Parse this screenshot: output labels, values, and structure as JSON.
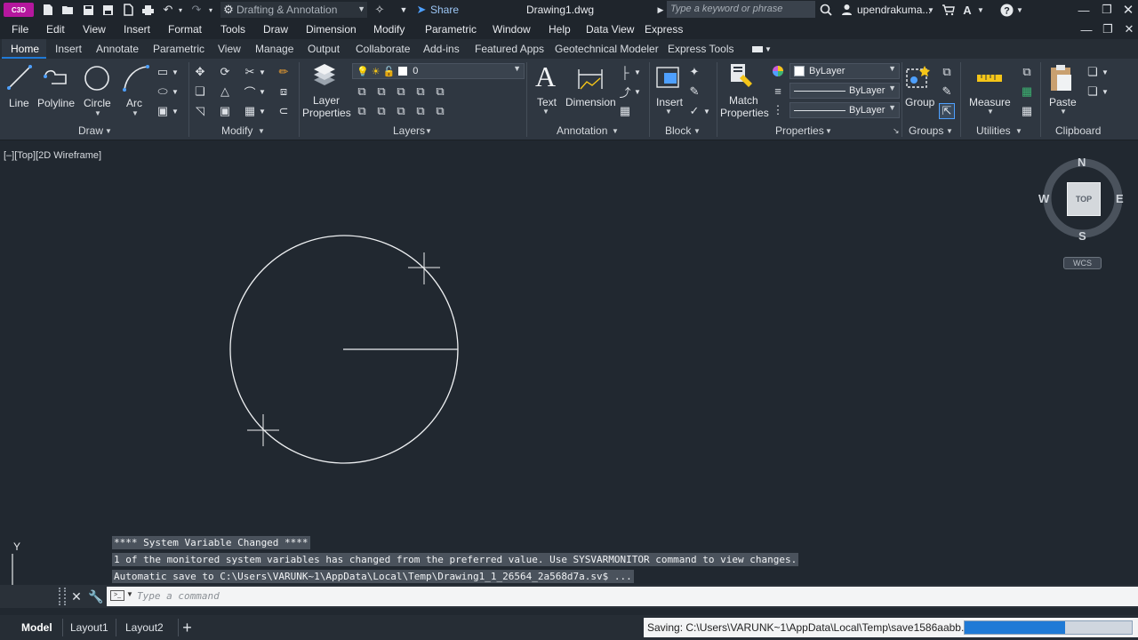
{
  "titlebar": {
    "app_badge": "C3D",
    "workspace": "Drafting & Annotation",
    "share_label": "Share",
    "document_title": "Drawing1.dwg",
    "search_placeholder": "Type a keyword or phrase",
    "user_name": "upendrakuma...",
    "icons": [
      "new-icon",
      "open-icon",
      "save-icon",
      "save-as-icon",
      "export-icon",
      "print-icon",
      "undo-icon",
      "redo-icon",
      "gear-icon",
      "share-icon",
      "search-icon",
      "user-icon",
      "cart-icon",
      "autodesk-icon",
      "help-icon",
      "minimize-icon",
      "restore-icon",
      "close-icon"
    ]
  },
  "menubar": {
    "items": [
      "File",
      "Edit",
      "View",
      "Insert",
      "Format",
      "Tools",
      "Draw",
      "Dimension",
      "Modify",
      "Parametric",
      "Window",
      "Help",
      "Data View",
      "Express"
    ]
  },
  "ribbon_tabs": {
    "items": [
      "Home",
      "Insert",
      "Annotate",
      "Parametric",
      "View",
      "Manage",
      "Output",
      "Collaborate",
      "Add-ins",
      "Featured Apps",
      "Geotechnical Modeler",
      "Express Tools"
    ],
    "active": "Home"
  },
  "ribbon": {
    "draw": {
      "title": "Draw",
      "tools": [
        "Line",
        "Polyline",
        "Circle",
        "Arc"
      ]
    },
    "modify": {
      "title": "Modify"
    },
    "layers": {
      "title": "Layers",
      "big_label_1": "Layer",
      "big_label_2": "Properties",
      "current_layer": "0"
    },
    "annotation": {
      "title": "Annotation",
      "text_label": "Text",
      "dimension_label": "Dimension"
    },
    "block": {
      "title": "Block",
      "insert_label": "Insert"
    },
    "properties": {
      "title": "Properties",
      "match_label_1": "Match",
      "match_label_2": "Properties",
      "color": "ByLayer",
      "linetype": "ByLayer",
      "lineweight": "ByLayer"
    },
    "groups": {
      "title": "Groups",
      "group_label": "Group"
    },
    "utilities": {
      "title": "Utilities",
      "measure_label": "Measure"
    },
    "clipboard": {
      "title": "Clipboard",
      "paste_label": "Paste"
    }
  },
  "viewport": {
    "view_label": "[–][Top][2D Wireframe]",
    "viewcube": {
      "north": "N",
      "south": "S",
      "east": "E",
      "west": "W",
      "face": "TOP",
      "ucs": "WCS"
    },
    "ucs_y": "Y"
  },
  "command": {
    "history": [
      "**** System Variable Changed ****",
      "1 of the monitored system variables has changed from the preferred value. Use SYSVARMONITOR command to view changes.",
      "Automatic save to C:\\Users\\VARUNK~1\\AppData\\Local\\Temp\\Drawing1_1_26564_2a568d7a.sv$ ..."
    ],
    "placeholder": "Type a command"
  },
  "statusbar": {
    "tabs": [
      "Model",
      "Layout1",
      "Layout2"
    ],
    "active_tab": "Model",
    "saving_text": "Saving: C:\\Users\\VARUNK~1\\AppData\\Local\\Temp\\save1586aabb.tmp",
    "progress": 0.6
  },
  "colors": {
    "background": "#212830",
    "ribbon": "#2f3741",
    "accent": "#1f7ad6",
    "app_badge": "#b5179e"
  }
}
